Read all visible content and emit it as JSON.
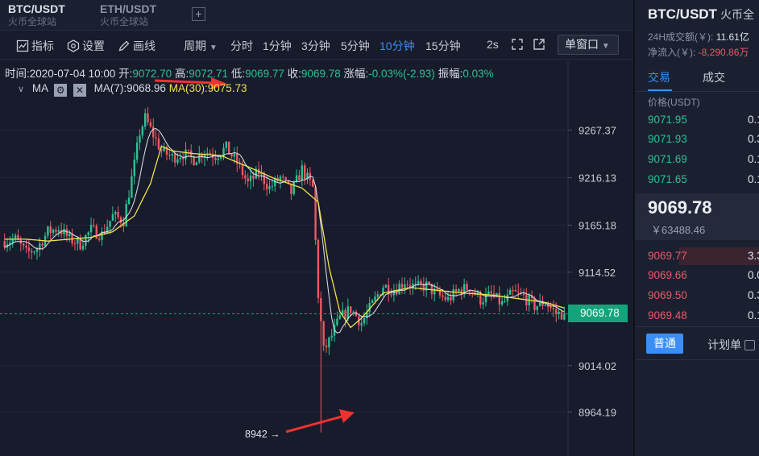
{
  "tabs": [
    {
      "pair": "BTC/USDT",
      "exchange": "火币全球站"
    },
    {
      "pair": "ETH/USDT",
      "exchange": "火币全球站"
    }
  ],
  "tab_add_label": "+",
  "toolbar": {
    "indicator": "指标",
    "settings": "设置",
    "draw": "画线",
    "period": "周期",
    "intervals": [
      "分时",
      "1分钟",
      "3分钟",
      "5分钟",
      "10分钟",
      "15分钟"
    ],
    "active_interval": "10分钟",
    "refresh": "2s",
    "window_mode": "单窗口"
  },
  "ohlc": {
    "time_label": "时间:",
    "time": "2020-07-04 10:00",
    "open_label": "开:",
    "open": "9072.70",
    "high_label": "高:",
    "high": "9072.71",
    "low_label": "低:",
    "low": "9069.77",
    "close_label": "收:",
    "close": "9069.78",
    "change_label": "涨幅:",
    "change": "-0.03%(-2.93)",
    "amplitude_label": "振幅:",
    "amplitude": "0.03%"
  },
  "ma": {
    "label": "MA",
    "ma7_label": "MA(7):",
    "ma7": "9068.96",
    "ma30_label": "MA(30):",
    "ma30": "9075.73"
  },
  "colors": {
    "up": "#2cc293",
    "down": "#ea5a64",
    "ma7": "#e6eaf2",
    "ma30": "#f2e24d",
    "accent": "#3a8ef6",
    "price_tag": "#14a37b",
    "arrow": "#f0312f"
  },
  "chart_data": {
    "type": "candlestick",
    "yticks": [
      9267.37,
      9216.13,
      9165.18,
      9114.52,
      9014.02,
      8964.19
    ],
    "ytick_labels": [
      "9267.37",
      "9216.13",
      "9165.18",
      "9114.52",
      "9014.02",
      "8964.19"
    ],
    "ylim": [
      8935,
      9305
    ],
    "current_price": 9069.78,
    "current_price_label": "9069.78",
    "low_marker_value": 8942,
    "low_marker_label": "8942 →",
    "close_path": [
      [
        0,
        9148
      ],
      [
        4,
        9150
      ],
      [
        8,
        9135
      ],
      [
        12,
        9140
      ],
      [
        16,
        9158
      ],
      [
        20,
        9162
      ],
      [
        24,
        9150
      ],
      [
        28,
        9145
      ],
      [
        32,
        9160
      ],
      [
        36,
        9155
      ],
      [
        40,
        9175
      ],
      [
        44,
        9170
      ],
      [
        48,
        9230
      ],
      [
        50,
        9265
      ],
      [
        52,
        9280
      ],
      [
        54,
        9268
      ],
      [
        58,
        9245
      ],
      [
        62,
        9238
      ],
      [
        66,
        9242
      ],
      [
        70,
        9236
      ],
      [
        74,
        9245
      ],
      [
        78,
        9240
      ],
      [
        82,
        9248
      ],
      [
        86,
        9232
      ],
      [
        90,
        9210
      ],
      [
        94,
        9222
      ],
      [
        98,
        9205
      ],
      [
        102,
        9216
      ],
      [
        106,
        9200
      ],
      [
        110,
        9225
      ],
      [
        114,
        9205
      ],
      [
        116,
        9090
      ],
      [
        118,
        9030
      ],
      [
        120,
        9040
      ],
      [
        124,
        9065
      ],
      [
        128,
        9075
      ],
      [
        132,
        9060
      ],
      [
        136,
        9080
      ],
      [
        140,
        9100
      ],
      [
        144,
        9095
      ],
      [
        148,
        9105
      ],
      [
        152,
        9098
      ],
      [
        156,
        9100
      ],
      [
        160,
        9090
      ],
      [
        164,
        9085
      ],
      [
        168,
        9095
      ],
      [
        172,
        9098
      ],
      [
        176,
        9085
      ],
      [
        180,
        9090
      ],
      [
        184,
        9080
      ],
      [
        188,
        9092
      ],
      [
        192,
        9088
      ],
      [
        196,
        9078
      ],
      [
        200,
        9082
      ],
      [
        204,
        9070
      ],
      [
        207,
        9069.78
      ]
    ],
    "ma30_path": [
      [
        0,
        9150
      ],
      [
        8,
        9150
      ],
      [
        16,
        9148
      ],
      [
        24,
        9150
      ],
      [
        32,
        9152
      ],
      [
        40,
        9158
      ],
      [
        48,
        9175
      ],
      [
        54,
        9210
      ],
      [
        58,
        9250
      ],
      [
        62,
        9245
      ],
      [
        70,
        9242
      ],
      [
        80,
        9240
      ],
      [
        90,
        9228
      ],
      [
        100,
        9215
      ],
      [
        110,
        9205
      ],
      [
        116,
        9190
      ],
      [
        120,
        9120
      ],
      [
        124,
        9072
      ],
      [
        128,
        9055
      ],
      [
        132,
        9065
      ],
      [
        140,
        9092
      ],
      [
        150,
        9098
      ],
      [
        160,
        9095
      ],
      [
        170,
        9092
      ],
      [
        180,
        9090
      ],
      [
        190,
        9086
      ],
      [
        200,
        9082
      ],
      [
        207,
        9076
      ]
    ],
    "n_bars": 208
  },
  "right_panel": {
    "pair": "BTC/USDT",
    "pair_sub": "火币全",
    "volume_label": "24H成交额(￥):",
    "volume": "11.61亿",
    "inflow_label": "净流入(￥):",
    "inflow": "-8,290.86万",
    "tab_trade": "交易",
    "tab_deals": "成交",
    "price_header": "价格(USDT)",
    "buy_orders": [
      {
        "price": "9071.95",
        "qty": "0.1"
      },
      {
        "price": "9071.93",
        "qty": "0.3"
      },
      {
        "price": "9071.69",
        "qty": "0.1"
      },
      {
        "price": "9071.65",
        "qty": "0.1"
      }
    ],
    "last_price": "9069.78",
    "last_price_cny": "￥63488.46",
    "sell_orders": [
      {
        "price": "9069.77",
        "qty": "3.3"
      },
      {
        "price": "9069.66",
        "qty": "0.0"
      },
      {
        "price": "9069.50",
        "qty": "0.3"
      },
      {
        "price": "9069.48",
        "qty": "0.1"
      }
    ],
    "mode_normal": "普通",
    "mode_plan": "计划单"
  }
}
